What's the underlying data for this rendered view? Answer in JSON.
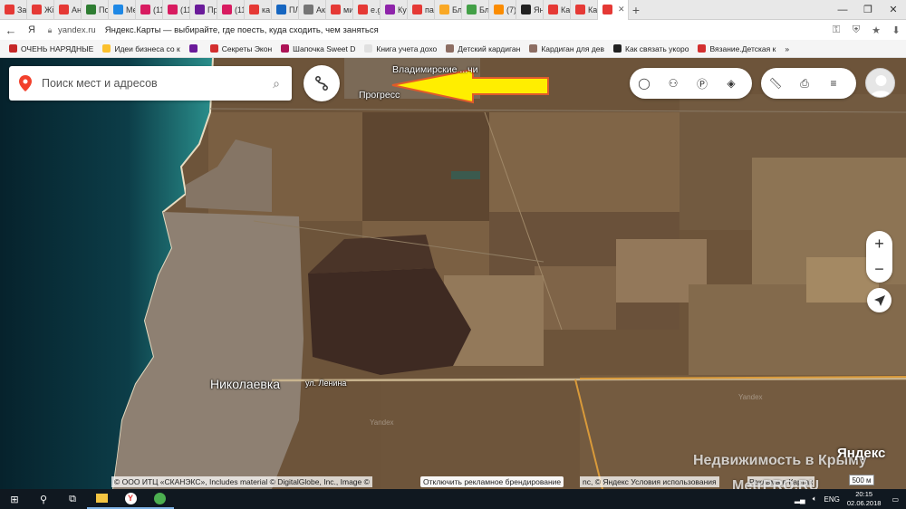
{
  "tabs": [
    {
      "label": "За",
      "color": "#e53935"
    },
    {
      "label": "Жі",
      "color": "#e53935"
    },
    {
      "label": "Ан",
      "color": "#e53935"
    },
    {
      "label": "По",
      "color": "#2e7d32"
    },
    {
      "label": "Ме",
      "color": "#1e88e5"
    },
    {
      "label": "(11",
      "color": "#d81b60"
    },
    {
      "label": "(11",
      "color": "#d81b60"
    },
    {
      "label": "Пр",
      "color": "#6a1b9a"
    },
    {
      "label": "(11",
      "color": "#d81b60"
    },
    {
      "label": "ка",
      "color": "#e53935"
    },
    {
      "label": "ПЛ",
      "color": "#1565c0"
    },
    {
      "label": "Ак",
      "color": "#757575"
    },
    {
      "label": "ми",
      "color": "#e53935"
    },
    {
      "label": "e.g",
      "color": "#e53935"
    },
    {
      "label": "Ку",
      "color": "#8e24aa"
    },
    {
      "label": "па",
      "color": "#e53935"
    },
    {
      "label": "Бл",
      "color": "#f9a825"
    },
    {
      "label": "Бл",
      "color": "#43a047"
    },
    {
      "label": "(7)",
      "color": "#fb8c00"
    },
    {
      "label": "Ян",
      "color": "#212121"
    },
    {
      "label": "Ка",
      "color": "#e53935"
    },
    {
      "label": "Ка",
      "color": "#e53935"
    },
    {
      "label": "",
      "color": "#e53935",
      "active": true
    }
  ],
  "address": {
    "domain": "yandex.ru",
    "title": "Яндекс.Карты — выбирайте, где поесть, куда сходить, чем заняться"
  },
  "bookmarks": [
    {
      "label": "ОЧЕНЬ НАРЯДНЫЕ",
      "color": "#c62828"
    },
    {
      "label": "Идеи бизнеса со к",
      "color": "#fbc02d"
    },
    {
      "label": "",
      "color": "#6a1b9a"
    },
    {
      "label": "Секреты Экон",
      "color": "#d32f2f"
    },
    {
      "label": "Шапочка Sweet D",
      "color": "#ad1457"
    },
    {
      "label": "Книга учета дохо",
      "color": "#e0e0e0"
    },
    {
      "label": "Детский кардиган",
      "color": "#8d6e63"
    },
    {
      "label": "Кардиган для дев",
      "color": "#8d6e63"
    },
    {
      "label": "Как связать укоро",
      "color": "#212121"
    },
    {
      "label": "Вязание.Детская к",
      "color": "#d32f2f"
    }
  ],
  "search": {
    "placeholder": "Поиск мест и адресов"
  },
  "map_labels": {
    "vladimirskoe": "Владимирские ...чи",
    "progress": "Прогресс",
    "nikolaevka": "Николаевка",
    "street": "ул. Ленина",
    "yandex_wm": "Yandex"
  },
  "footer": {
    "copyright_left": "© ООО ИТЦ «СКАНЭКС», Includes material © DigitalGlobe, Inc., Image ©",
    "ad_toggle": "Отключить рекламное брендирование",
    "copyright_right": "nc, © Яндекс Условия использования",
    "advert": "Реклама в Картах",
    "logo": "Яндекс",
    "scale": "500 м"
  },
  "site_watermark": {
    "line1": "Недвижимость в Крыму",
    "line2": "MetrPRO.RU"
  },
  "tray": {
    "lang": "ENG",
    "time": "20:15",
    "date": "02.06.2018"
  },
  "colors": {
    "sea_deep": "#0a2e3a",
    "sea_coast": "#2a8a8a",
    "field_brown": "#6b5238",
    "field_light": "#8a7152",
    "arrow_yellow": "#ffee00",
    "arrow_red": "#d32f2f",
    "road": "#d99a3a"
  }
}
